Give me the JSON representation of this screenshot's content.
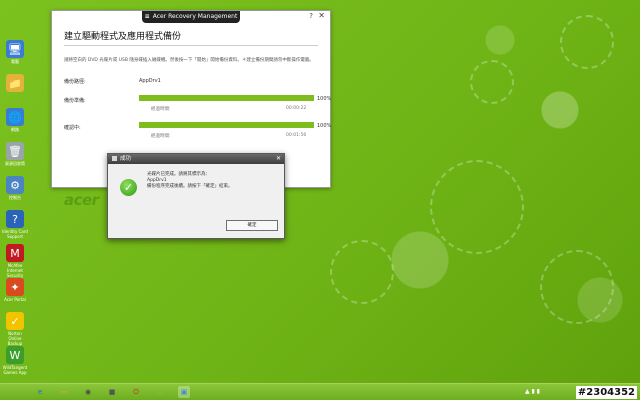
{
  "desktop": {
    "icons": [
      {
        "label": "電腦",
        "icon": "computer-icon",
        "glyph": "🖥",
        "color": "#3a7bd5"
      },
      {
        "label": "",
        "icon": "folder-icon",
        "glyph": "📁",
        "color": "#e2b23a"
      },
      {
        "label": "網路",
        "icon": "network-icon",
        "glyph": "🌐",
        "color": "#3a7bd5"
      },
      {
        "label": "資源回收筒",
        "icon": "recycle-bin-icon",
        "glyph": "🗑",
        "color": "#9aa5a9"
      },
      {
        "label": "控制台",
        "icon": "control-panel-icon",
        "glyph": "⚙",
        "color": "#4b84c4"
      },
      {
        "label": "Identity Card Support",
        "icon": "identity-card-icon",
        "glyph": "?",
        "color": "#2b63b8"
      },
      {
        "label": "McAfee Internet Security",
        "icon": "mcafee-icon",
        "glyph": "M",
        "color": "#c0191f"
      },
      {
        "label": "Acer Portal",
        "icon": "acer-portal-icon",
        "glyph": "✦",
        "color": "#d94a1e"
      },
      {
        "label": "Norton Online Backup",
        "icon": "norton-icon",
        "glyph": "✓",
        "color": "#f2c400"
      },
      {
        "label": "WildTangent Games App",
        "icon": "wildtangent-icon",
        "glyph": "W",
        "color": "#3c9e2a"
      }
    ]
  },
  "window": {
    "app_title": "Acer Recovery Management",
    "logo_glyph": "≡",
    "help": "?",
    "close": "✕",
    "heading": "建立驅動程式及應用程式備份",
    "instruction": "請將空白的 DVD 光碟片或 USB 隨身碟插入磁碟機。然後按一下「開始」開始備份資料。＊建立備份期間請勿中斷操作電腦。",
    "source_label": "備份路徑:",
    "source_value": "AppDrv1",
    "rows": [
      {
        "label": "備份準備:",
        "sub": "經過時間:",
        "time": "00:00:22",
        "percent_text": "100%",
        "fraction": 1.0
      },
      {
        "label": "確認中:",
        "sub": "經過時間:",
        "time": "00:01:56",
        "percent_text": "100%",
        "fraction": 1.0
      }
    ],
    "brand": "acer"
  },
  "dialog": {
    "title": "成功",
    "close": "✕",
    "check": "✓",
    "line1": "光碟片已完成。請將其標示為：",
    "line2": "AppDrv1",
    "line3": "備份程序完成後續。請按下「確定」結束。",
    "ok_label": "確定"
  },
  "taskbar": {
    "items": [
      {
        "name": "ie-icon",
        "glyph": "e",
        "color": "#1e6fd0"
      },
      {
        "name": "explorer-icon",
        "glyph": "▭",
        "color": "#e6b232"
      },
      {
        "name": "media-icon",
        "glyph": "◉",
        "color": "#4a4a4a"
      },
      {
        "name": "camera-icon",
        "glyph": "■",
        "color": "#555555"
      },
      {
        "name": "power-icon",
        "glyph": "⏻",
        "color": "#c81e1e"
      },
      {
        "name": "app-icon",
        "glyph": "◎",
        "color": "#8db84a"
      },
      {
        "name": "recovery-icon",
        "glyph": "▣",
        "color": "#3a8fd6"
      }
    ],
    "tray_glyph": "▲ ▮ ▮"
  },
  "watermark": "#2304352"
}
